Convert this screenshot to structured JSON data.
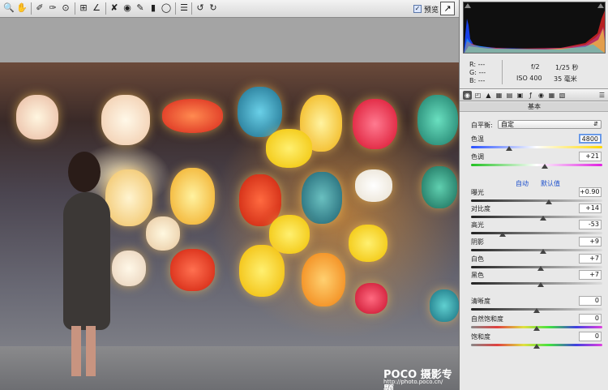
{
  "toolbar": {
    "tools": [
      "zoom-tool",
      "hand-tool",
      "white-balance-tool",
      "color-sampler-tool",
      "target-adjustment-tool",
      "crop-tool",
      "straighten-tool",
      "spot-removal-tool",
      "red-eye-tool",
      "adjustment-brush-tool",
      "graduated-filter-tool",
      "radial-filter-tool",
      "preferences-tool",
      "rotate-ccw-tool",
      "rotate-cw-tool"
    ],
    "preview_label": "预览",
    "preview_checked": true
  },
  "photo": {
    "watermark_brand": "POCO 摄影专题",
    "watermark_url": "http://photo.poco.cn/"
  },
  "info": {
    "r_label": "R:",
    "r_value": "---",
    "g_label": "G:",
    "g_value": "---",
    "b_label": "B:",
    "b_value": "---",
    "aperture": "f/2",
    "shutter": "1/25 秒",
    "iso": "ISO 400",
    "focal": "35 毫米"
  },
  "panel": {
    "section_title": "基本",
    "white_balance_label": "白平衡:",
    "white_balance_value": "自定",
    "auto_link": "自动",
    "default_link": "默认值",
    "sliders": [
      {
        "label": "色温",
        "value": "4800",
        "pos": 0.29
      },
      {
        "label": "色调",
        "value": "+21",
        "pos": 0.56
      },
      {
        "label": "曝光",
        "value": "+0.90",
        "pos": 0.59
      },
      {
        "label": "对比度",
        "value": "+14",
        "pos": 0.55
      },
      {
        "label": "高光",
        "value": "-53",
        "pos": 0.24
      },
      {
        "label": "阴影",
        "value": "+9",
        "pos": 0.55
      },
      {
        "label": "白色",
        "value": "+7",
        "pos": 0.53
      },
      {
        "label": "黑色",
        "value": "+7",
        "pos": 0.53
      },
      {
        "label": "清晰度",
        "value": "0",
        "pos": 0.5
      },
      {
        "label": "自然饱和度",
        "value": "0",
        "pos": 0.5
      },
      {
        "label": "饱和度",
        "value": "0",
        "pos": 0.5
      }
    ]
  }
}
